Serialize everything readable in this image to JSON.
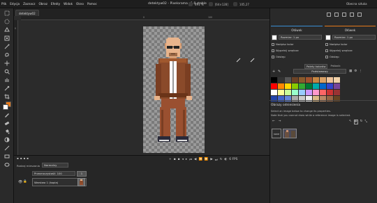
{
  "menu": [
    "Plik",
    "Edycja",
    "Zaznacz",
    "Obraz",
    "Efekty",
    "Widok",
    "Okno",
    "Pomoc"
  ],
  "window_title": "detektyw02 - Pixelorama v1.0.stable",
  "stats": {
    "zoom": "491 %",
    "size": "[64×128]",
    "cursor": "105,27"
  },
  "workspace": "Obecna sztuka",
  "tabs": [
    "detektyw02"
  ],
  "rulers": {
    "top": [
      "0",
      "100"
    ],
    "left": [
      "0"
    ]
  },
  "timeline": {
    "blend_label": "Rodzaj mieszania",
    "blend_value": "Normalny",
    "opacity_label": "Przezroczystość: 100",
    "layer_name": "Warstwa 1 (kopia)",
    "frame_number": "1",
    "fps": "6 FPS"
  },
  "tool_options": {
    "left": {
      "title": "Ołówek",
      "size_label": "Rozmiar: 1 px",
      "options": [
        "Nadpisz kolor",
        "Wypełnij wnętrze",
        "Odstęp"
      ]
    },
    "right": {
      "title": "Ołówek",
      "size_label": "Rozmiar: 1 px",
      "options": [
        "Nadpisz kolor",
        "Wypełnij wnętrze",
        "Odstęp"
      ]
    },
    "left_color": "#3a8fd6",
    "right_color": "#e87a1a"
  },
  "palette_panel": {
    "tabs": [
      "Palety kolorów",
      "Próbnik"
    ],
    "palette_name": "Podstawowy",
    "colors": [
      "#000000",
      "#333333",
      "#555555",
      "#6b4226",
      "#8a5a2b",
      "#a0522d",
      "#c68642",
      "#d9a066",
      "#eec39a",
      "#f2d2a9",
      "#ff0000",
      "#ff8800",
      "#ffd800",
      "#88cc00",
      "#33aa33",
      "#007733",
      "#00aaaa",
      "#0066cc",
      "#3344cc",
      "#774499",
      "#ffffff",
      "#ffff99",
      "#ccff99",
      "#99ffcc",
      "#99ccff",
      "#cc99ff",
      "#ff99cc",
      "#ff6666",
      "#cc3333",
      "#993333",
      "#2244aa",
      "#4466cc",
      "#6688dd",
      "#aaaaaa",
      "#cccccc",
      "#eeeeee",
      "#ddbb88",
      "#bb8866",
      "#996644",
      "#664422"
    ]
  },
  "reference_panel": {
    "title": "Obrazy odniesienia",
    "description_line1": "Select an image below to change its properties.",
    "description_line2": "Note that you cannot draw while a reference image is selected.",
    "none_label": "none"
  }
}
